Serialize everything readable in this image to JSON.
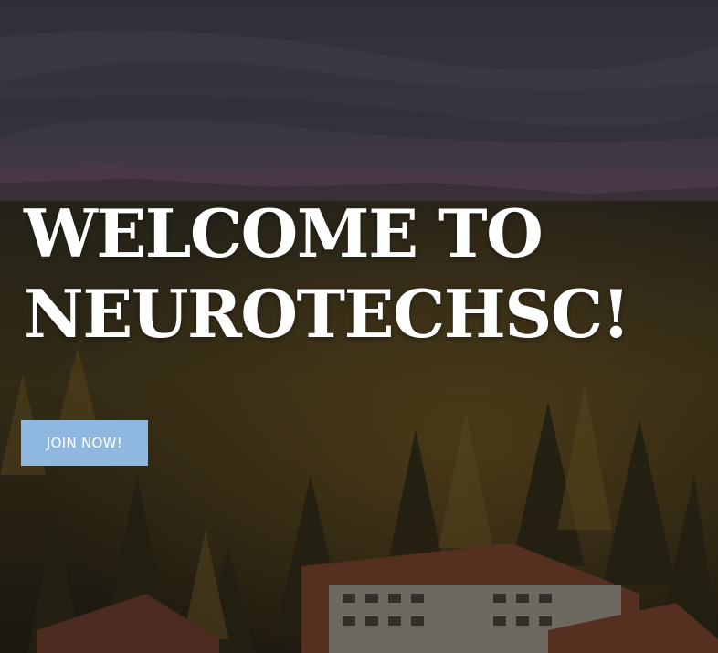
{
  "hero": {
    "title_line1": "WELCOME TO",
    "title_line2": "NEUROTECHSC!",
    "cta_label": "JOIN NOW!"
  },
  "colors": {
    "cta_background": "#8fb8e1",
    "title_text": "#ffffff"
  }
}
